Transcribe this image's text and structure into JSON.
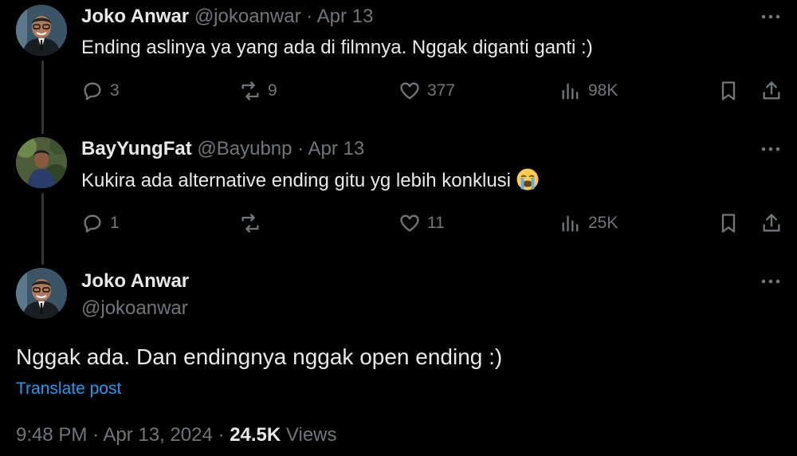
{
  "replies": [
    {
      "name": "Joko Anwar",
      "handle": "@jokoanwar",
      "date": "Apr 13",
      "text": "Ending aslinya ya yang ada di filmnya. Nggak diganti ganti :)",
      "stats": {
        "replies": "3",
        "reposts": "9",
        "likes": "377",
        "views": "98K"
      }
    },
    {
      "name": "BayYungFat",
      "handle": "@Bayubnp",
      "date": "Apr 13",
      "text": "Kukira ada alternative ending gitu yg lebih konklusi",
      "emoji": "loudly-crying-face",
      "stats": {
        "replies": "1",
        "reposts": "",
        "likes": "11",
        "views": "25K"
      }
    }
  ],
  "main_tweet": {
    "name": "Joko Anwar",
    "handle": "@jokoanwar",
    "text": "Nggak ada. Dan endingnya nggak open ending :)",
    "translate_label": "Translate post",
    "time": "9:48 PM",
    "date": "Apr 13, 2024",
    "views_count": "24.5K",
    "views_label": "Views"
  },
  "separator": "·",
  "colors": {
    "background": "#000000",
    "text": "#e7e9ea",
    "muted": "#71767b",
    "link": "#1d9bf0",
    "thread_line": "#333639"
  }
}
